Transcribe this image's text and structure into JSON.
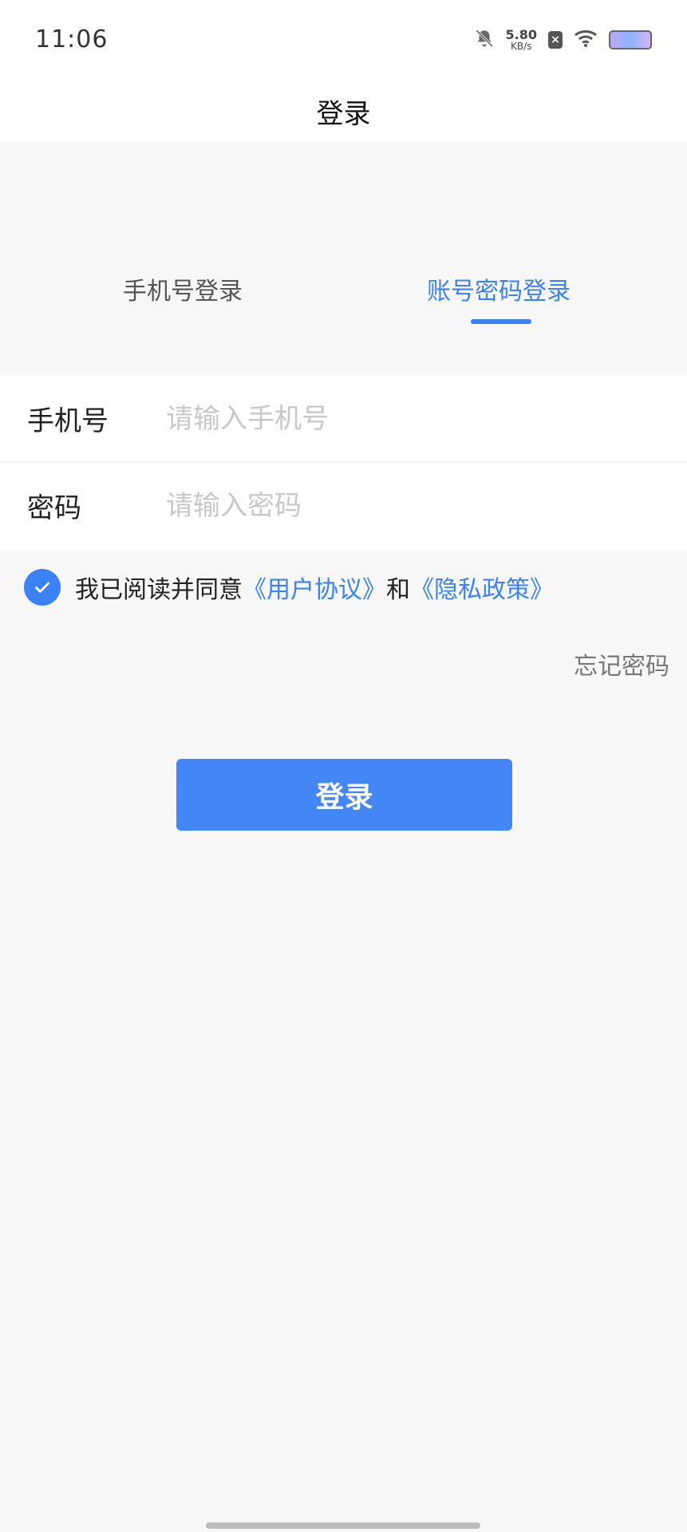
{
  "status_bar": {
    "time": "11:06",
    "speed_num": "5.80",
    "speed_unit": "KB/s",
    "icons": [
      "bell-muted-icon",
      "close-badge-icon",
      "wifi-icon",
      "battery-icon"
    ]
  },
  "header": {
    "title": "登录"
  },
  "tabs": [
    {
      "label": "手机号登录",
      "active": false
    },
    {
      "label": "账号密码登录",
      "active": true
    }
  ],
  "form": {
    "phone_label": "手机号",
    "phone_placeholder": "请输入手机号",
    "password_label": "密码",
    "password_placeholder": "请输入密码"
  },
  "agreement": {
    "checked": true,
    "prefix": "我已阅读并同意",
    "user_agreement": "《用户协议》",
    "and": "和",
    "privacy_policy": "《隐私政策》"
  },
  "forgot_password": "忘记密码",
  "login_button": "登录",
  "colors": {
    "accent": "#3b82f6",
    "background": "#f7f7f8",
    "button": "#4287f5"
  }
}
